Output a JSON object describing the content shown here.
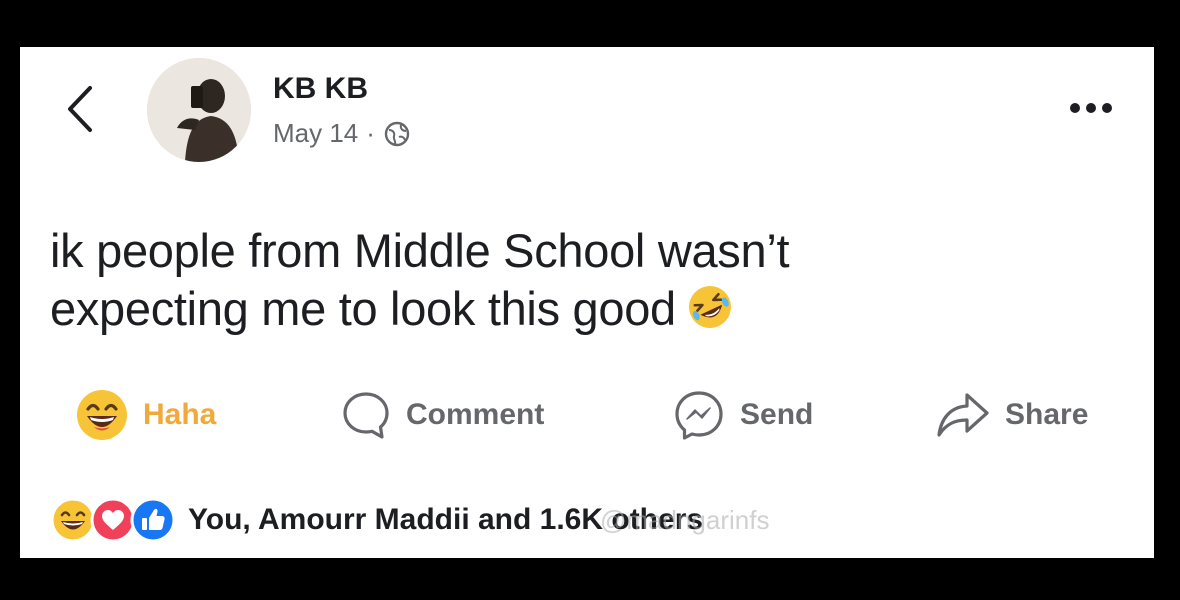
{
  "post": {
    "author": "KB KB",
    "date": "May 14",
    "separator": "·",
    "visibility_icon": "globe-icon",
    "text_line1": "ik people from Middle School wasn’t",
    "text_line2": "expecting me to look this good",
    "inline_emoji": "rolling-on-floor-laughing-emoji"
  },
  "actions": {
    "haha": "Haha",
    "comment": "Comment",
    "send": "Send",
    "share": "Share"
  },
  "reactions": {
    "summary": "You, Amourr Maddii and 1.6K others",
    "icons": [
      "haha-reaction-icon",
      "love-reaction-icon",
      "like-reaction-icon"
    ]
  },
  "watermark": "@madngarinfs",
  "colors": {
    "haha": "#f0a93a",
    "secondary_text": "#65676b",
    "primary_text": "#1c1e21",
    "love": "#f0405a",
    "like": "#1877f2"
  }
}
